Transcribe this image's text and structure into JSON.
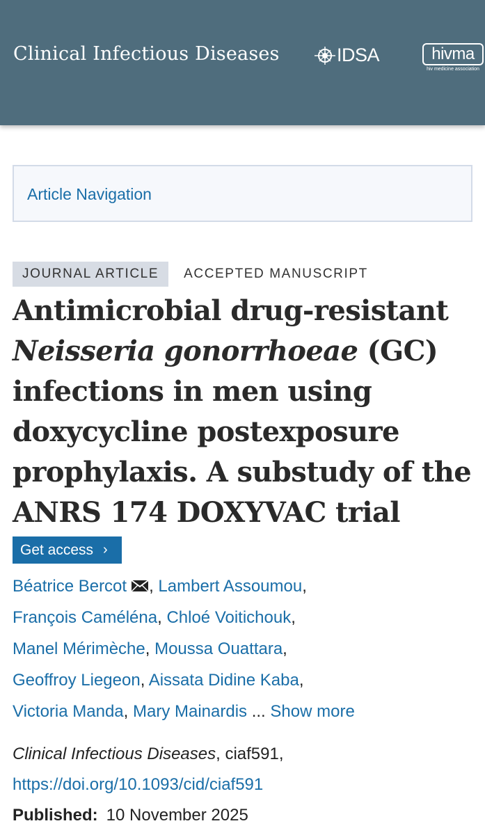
{
  "header": {
    "journal_name": "Clinical Infectious Diseases",
    "idsa_logo_text": "IDSA",
    "hivma_logo_text": "hivma",
    "hivma_logo_subtext": "hiv medicine association",
    "background_color": "#4f6d7d"
  },
  "article_navigation": {
    "label": "Article Navigation"
  },
  "tags": {
    "type": "JOURNAL ARTICLE",
    "status": "ACCEPTED MANUSCRIPT"
  },
  "title": {
    "part1": "Antimicrobial drug-resistant ",
    "species": "Neisseria gonorrhoeae",
    "part2": " (GC) infections in men using doxycycline postexposure prophylaxis. A substudy of the ANRS 174 DOXYVAC trial"
  },
  "access_button": {
    "label": "Get access",
    "icon": "chevron-right-icon"
  },
  "authors": {
    "list": [
      "Béatrice Bercot",
      "Lambert Assoumou",
      "François Caméléna",
      "Chloé Voitichouk",
      "Manel Mérimèche",
      "Moussa Ouattara",
      "Geoffroy Liegeon",
      "Aissata Didine Kaba",
      "Victoria Manda",
      "Mary Mainardis"
    ],
    "corresponding_icon": "mail-icon",
    "ellipsis": "...",
    "show_more": "Show more"
  },
  "citation": {
    "journal": "Clinical Infectious Diseases",
    "article_id": ", ciaf591,",
    "doi": "https://doi.org/10.1093/cid/ciaf591",
    "published_label": "Published:",
    "published_date": "10 November 2025"
  },
  "colors": {
    "link": "#1a6ea8",
    "tag_background": "#d7dce4",
    "nav_background": "#f6f8fc"
  }
}
